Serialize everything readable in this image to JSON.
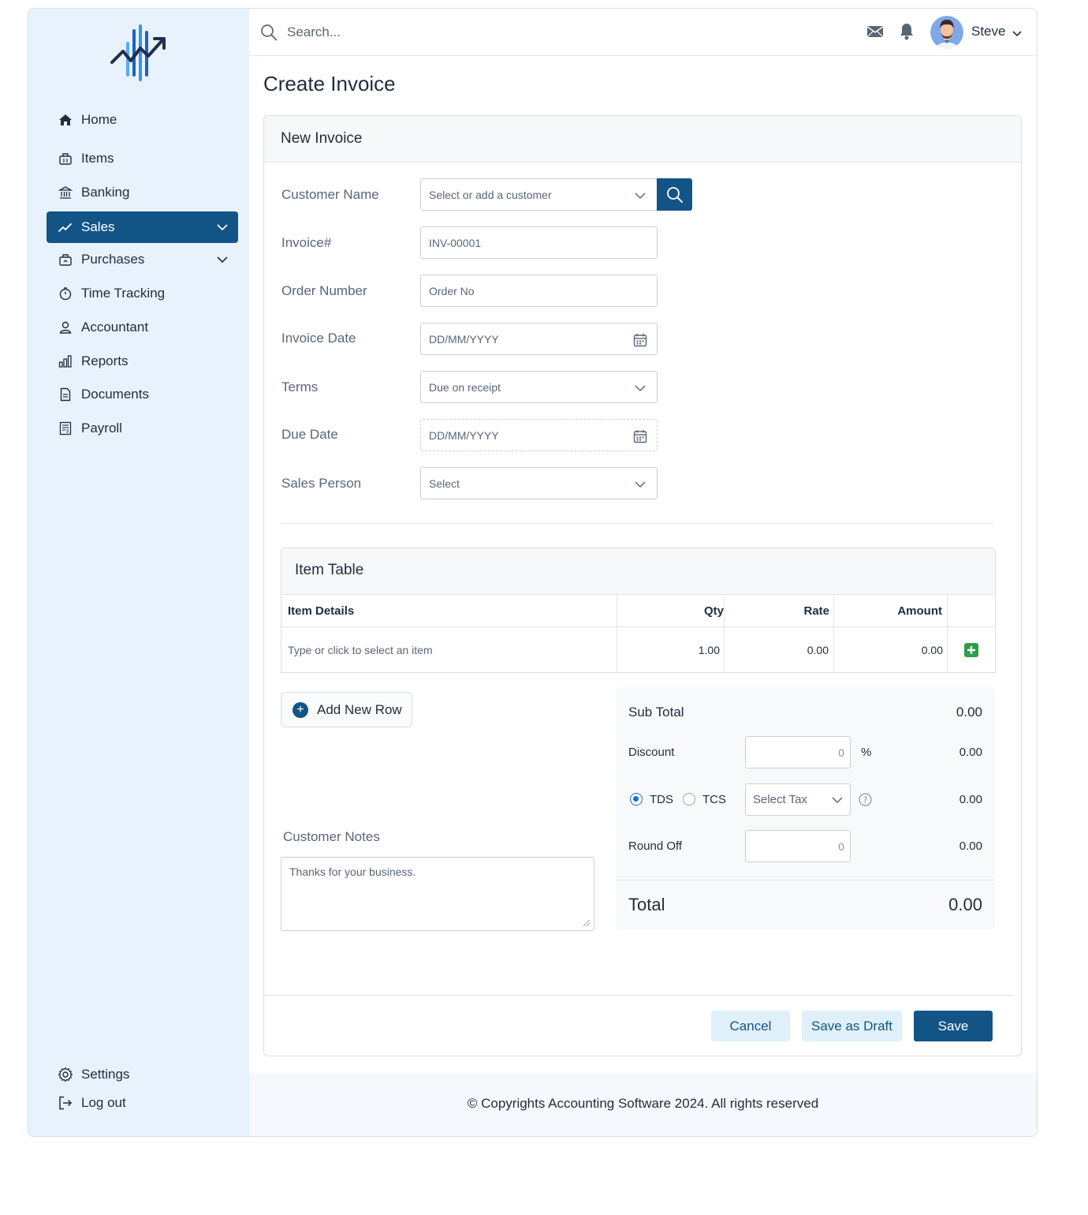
{
  "sidebar": {
    "logo": "chart-logo",
    "items": [
      {
        "label": "Home",
        "icon": "home-icon"
      },
      {
        "label": "Items",
        "icon": "items-icon"
      },
      {
        "label": "Banking",
        "icon": "bank-icon"
      },
      {
        "label": "Sales",
        "icon": "sales-trend-icon",
        "active": true,
        "expandable": true
      },
      {
        "label": "Purchases",
        "icon": "purchases-icon",
        "expandable": true
      },
      {
        "label": "Time Tracking",
        "icon": "timer-icon"
      },
      {
        "label": "Accountant",
        "icon": "person-icon"
      },
      {
        "label": "Reports",
        "icon": "bar-chart-icon"
      },
      {
        "label": "Documents",
        "icon": "document-icon"
      },
      {
        "label": "Payroll",
        "icon": "payroll-icon"
      }
    ],
    "bottom": [
      {
        "label": "Settings",
        "icon": "gear-icon"
      },
      {
        "label": "Log out",
        "icon": "logout-icon"
      }
    ]
  },
  "topbar": {
    "search_placeholder": "Search...",
    "user_name": "Steve"
  },
  "page": {
    "title": "Create Invoice"
  },
  "form": {
    "card_title": "New Invoice",
    "fields": {
      "customer": {
        "label": "Customer Name",
        "value": "Select or add a customer"
      },
      "invoice_no": {
        "label": "Invoice#",
        "value": "INV-00001"
      },
      "order_no": {
        "label": "Order Number",
        "value": "Order No"
      },
      "invoice_date": {
        "label": "Invoice Date",
        "value": "DD/MM/YYYY"
      },
      "terms": {
        "label": "Terms",
        "value": "Due on receipt"
      },
      "due_date": {
        "label": "Due Date",
        "value": "DD/MM/YYYY"
      },
      "sales_person": {
        "label": "Sales Person",
        "value": "Select"
      }
    }
  },
  "item_table": {
    "title": "Item Table",
    "columns": [
      "Item Details",
      "Qty",
      "Rate",
      "Amount"
    ],
    "rows": [
      {
        "item": "Type or click to select an item",
        "qty": "1.00",
        "rate": "0.00",
        "amount": "0.00"
      }
    ],
    "add_row_label": "Add New Row"
  },
  "notes": {
    "label": "Customer Notes",
    "value": "Thanks for your business."
  },
  "totals": {
    "subtotal_label": "Sub Total",
    "subtotal": "0.00",
    "discount_label": "Discount",
    "discount_input": "0",
    "discount_unit": "%",
    "discount": "0.00",
    "tds_label": "TDS",
    "tcs_label": "TCS",
    "tax_select": "Select Tax",
    "tax": "0.00",
    "roundoff_label": "Round Off",
    "roundoff_input": "0",
    "roundoff": "0.00",
    "total_label": "Total",
    "total": "0.00"
  },
  "actions": {
    "cancel": "Cancel",
    "draft": "Save as Draft",
    "save": "Save"
  },
  "footer": {
    "text": "© Copyrights Accounting Software 2024. All rights reserved"
  },
  "colors": {
    "primary": "#135487",
    "sidebar_bg": "#e7f2fc",
    "add_green": "#2e9e47"
  }
}
